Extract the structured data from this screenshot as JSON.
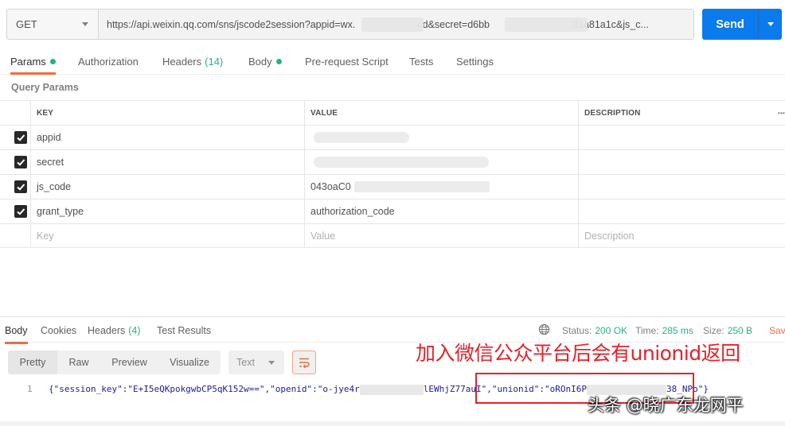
{
  "request": {
    "method": "GET",
    "url": "https://api.weixin.qq.com/sns/jscode2session?appid=wx.",
    "url_mid": "cd&secret=d6bb",
    "url_end": "31a81a1c&js_c...",
    "send_label": "Send"
  },
  "tabs": [
    {
      "label": "Params"
    },
    {
      "label": "Authorization"
    },
    {
      "label": "Headers",
      "count": "(14)"
    },
    {
      "label": "Body"
    },
    {
      "label": "Pre-request Script"
    },
    {
      "label": "Tests"
    },
    {
      "label": "Settings"
    }
  ],
  "section_title": "Query Params",
  "table": {
    "headers": [
      "KEY",
      "VALUE",
      "DESCRIPTION"
    ],
    "more": "•••",
    "rows": [
      {
        "key": "appid",
        "value": ""
      },
      {
        "key": "secret",
        "value": ""
      },
      {
        "key": "js_code",
        "value": "043oaC0"
      },
      {
        "key": "grant_type",
        "value": "authorization_code"
      }
    ],
    "placeholders": {
      "key": "Key",
      "value": "Value",
      "description": "Description"
    }
  },
  "response": {
    "tabs": [
      {
        "label": "Body"
      },
      {
        "label": "Cookies"
      },
      {
        "label": "Headers",
        "count": "(4)"
      },
      {
        "label": "Test Results"
      }
    ],
    "status_label": "Status:",
    "status_value": "200 OK",
    "time_label": "Time:",
    "time_value": "285 ms",
    "size_label": "Size:",
    "size_value": "250 B",
    "save_label": "Sav",
    "views": [
      "Pretty",
      "Raw",
      "Preview",
      "Visualize"
    ],
    "format": "Text",
    "line_number": "1",
    "code_a": "{\"session_key\":\"E+I5eQKpokgwbCP5qK152w==\",\"openid\":\"o-jye4r",
    "code_b": "lEWhjZ77auI\",\"unionid\":\"oROnI6P",
    "code_c": "38_NPo\"}"
  },
  "annotation": "加入微信公众平台后会有unionid返回",
  "watermark": "头条 @晓广东龙网平",
  "colors": {
    "accent": "#f26b3a",
    "send": "#097bed",
    "success": "#26b47f",
    "annotation": "#e8212a"
  }
}
